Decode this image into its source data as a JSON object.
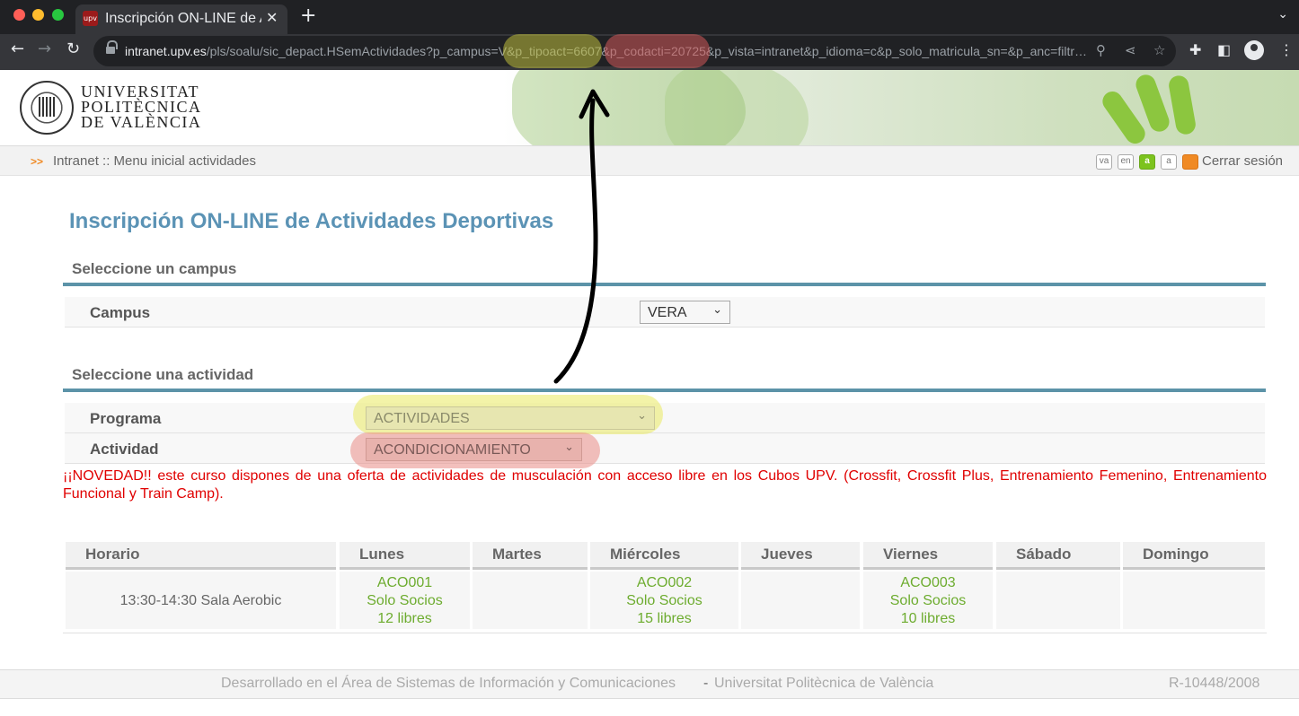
{
  "browser": {
    "tab_title": "Inscripción ON-LINE de Activ",
    "favicon_text": "upv",
    "url_host": "intranet.upv.es",
    "url_path": "/pls/soalu/sic_depact.HSemActividades?p_campus=V&p_tipoact=6607&p_codacti=20725&p_vista=intranet&p_idioma=c&p_solo_matricula_sn=&p_anc=filtr…"
  },
  "header": {
    "university_lines": [
      "UNIVERSITAT",
      "POLITÈCNICA",
      "DE VALÈNCIA"
    ]
  },
  "breadcrumb": {
    "arrows": ">>",
    "text": "Intranet :: Menu inicial actividades",
    "lang_buttons": [
      "va",
      "en",
      "a",
      "a"
    ],
    "logout": "Cerrar sesión"
  },
  "main": {
    "title": "Inscripción ON-LINE de Actividades Deportivas",
    "section_campus": "Seleccione un campus",
    "campus_label": "Campus",
    "campus_value": "VERA",
    "section_activity": "Seleccione una actividad",
    "programa_label": "Programa",
    "programa_value": "ACTIVIDADES",
    "actividad_label": "Actividad",
    "actividad_value": "ACONDICIONAMIENTO",
    "notice": "¡¡NOVEDAD!! este curso dispones de una oferta de actividades de musculación con acceso libre en los Cubos UPV. (Crossfit, Crossfit Plus, Entrenamiento Femenino, Entrenamiento Funcional y Train Camp)."
  },
  "schedule": {
    "headers": [
      "Horario",
      "Lunes",
      "Martes",
      "Miércoles",
      "Jueves",
      "Viernes",
      "Sábado",
      "Domingo"
    ],
    "time": "13:30-14:30 Sala Aerobic",
    "monday": [
      "ACO001",
      "Solo Socios",
      "12 libres"
    ],
    "wednesday": [
      "ACO002",
      "Solo Socios",
      "15 libres"
    ],
    "friday": [
      "ACO003",
      "Solo Socios",
      "10 libres"
    ]
  },
  "footer": {
    "left": "Desarrollado en el Área de Sistemas de Información y Comunicaciones",
    "separator": "-",
    "center": "Universitat Politècnica de València",
    "ref": "R-10448/2008"
  },
  "colors": {
    "title_blue": "#5b93b5",
    "rule_teal": "#5c93a8",
    "notice_red": "#e00000",
    "slot_green": "#6dac2f",
    "highlight_yellow": "#e7e6b0",
    "highlight_red": "#e8b2ad"
  },
  "icons": [
    "back-icon",
    "forward-icon",
    "reload-icon",
    "lock-icon",
    "zoom-icon",
    "share-icon",
    "star-icon",
    "extensions-icon",
    "sidepanel-icon",
    "profile-icon",
    "menu-icon",
    "close-icon",
    "new-tab-icon",
    "chevron-down-icon"
  ]
}
